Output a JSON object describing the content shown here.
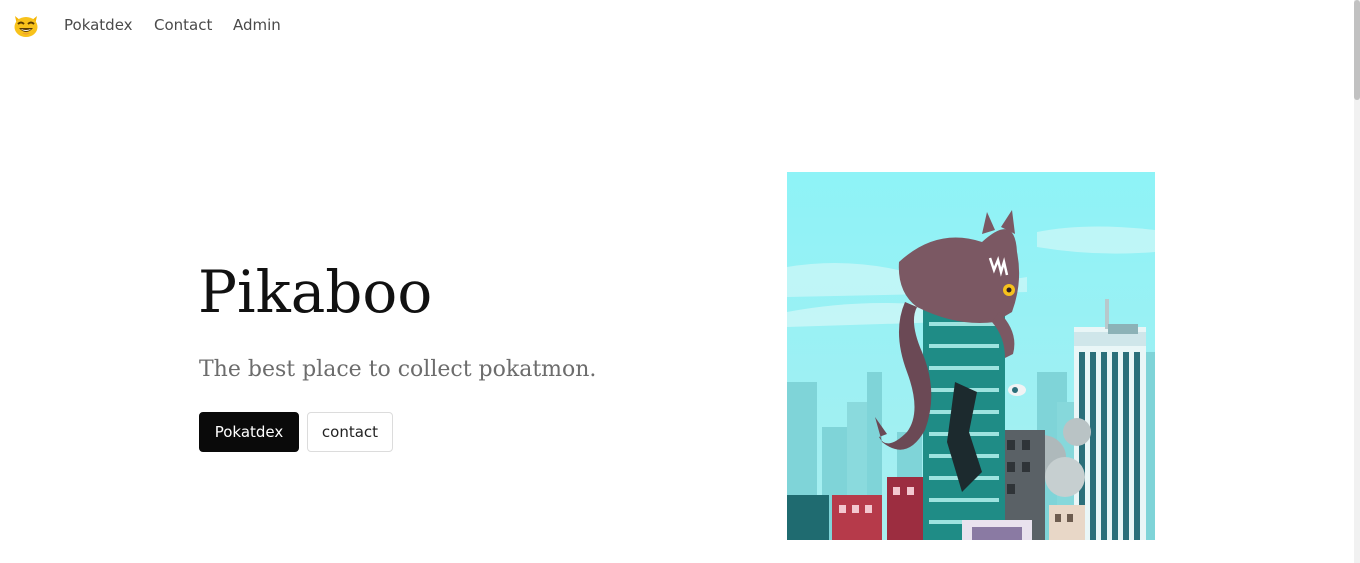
{
  "nav": {
    "logo_icon": "smiling-cat-icon",
    "links": [
      "Pokatdex",
      "Contact",
      "Admin"
    ]
  },
  "hero": {
    "title": "Pikaboo",
    "subtitle": "The best place to collect pokatmon.",
    "primary_button": "Pokatdex",
    "secondary_button": "contact",
    "image_icon": "monster-cat-on-skyscraper-illustration"
  },
  "colors": {
    "primary_button_bg": "#0a0a0a",
    "sky": "#8ef3f7",
    "subtitle": "#6c6c6c"
  }
}
